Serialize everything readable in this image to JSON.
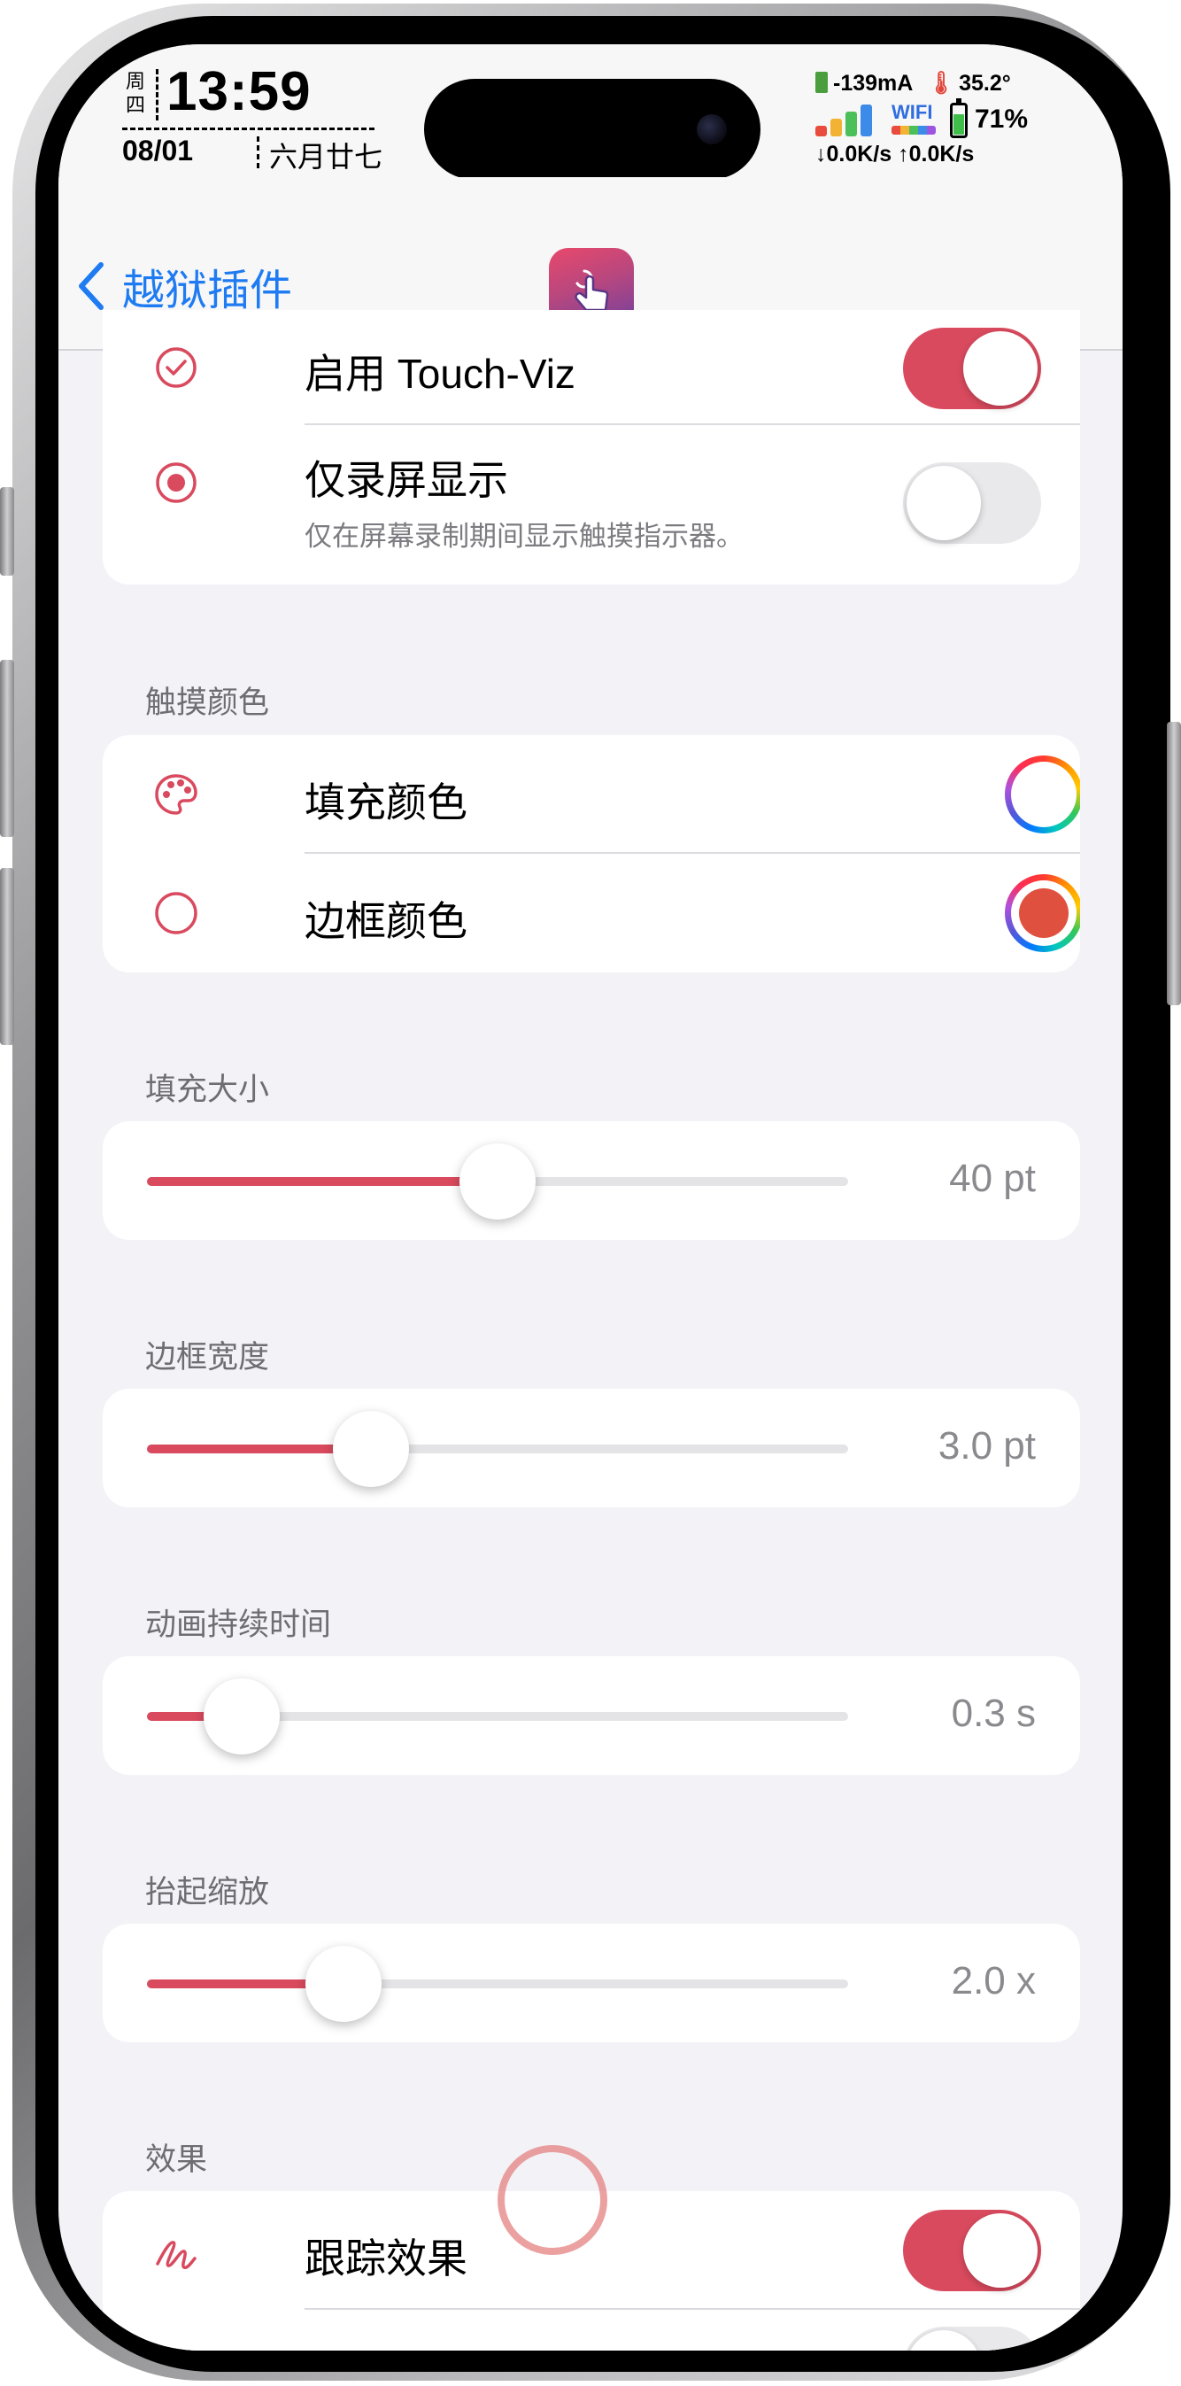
{
  "status_bar": {
    "weekday_line1": "周",
    "weekday_line2": "四",
    "time": "13:59",
    "date": "08/01",
    "lunar_date": "六月廿七",
    "current": "-139mA",
    "temperature": "35.2°",
    "wifi_label": "WIFI",
    "battery_percent": "71%",
    "battery_level": 0.71,
    "download_speed": "↓0.0K/s",
    "upload_speed": "↑0.0K/s"
  },
  "nav": {
    "back_label": "越狱插件",
    "app_icon": "hand-tap-icon"
  },
  "general": {
    "enable": {
      "icon": "checkmark-circle-icon",
      "title": "启用 Touch-Viz",
      "on": true
    },
    "record_only": {
      "icon": "record-circle-icon",
      "title": "仅录屏显示",
      "subtitle": "仅在屏幕录制期间显示触摸指示器。",
      "on": false
    }
  },
  "touch_color": {
    "header": "触摸颜色",
    "fill": {
      "icon": "palette-icon",
      "title": "填充颜色",
      "color": "#ffffff"
    },
    "border": {
      "icon": "circle-outline-icon",
      "title": "边框颜色",
      "color": "#e0503e"
    }
  },
  "fill_size": {
    "header": "填充大小",
    "value_text": "40 pt",
    "fraction": 0.5
  },
  "border_width": {
    "header": "边框宽度",
    "value_text": "3.0 pt",
    "fraction": 0.32
  },
  "anim_duration": {
    "header": "动画持续时间",
    "value_text": "0.3 s",
    "fraction": 0.135
  },
  "lift_scale": {
    "header": "抬起缩放",
    "value_text": "2.0 x",
    "fraction": 0.28
  },
  "effects": {
    "header": "效果",
    "trail": {
      "icon": "scribble-icon",
      "title": "跟踪效果",
      "on": true
    }
  },
  "colors": {
    "accent": "#d94a5e",
    "link": "#1f7bf2"
  }
}
